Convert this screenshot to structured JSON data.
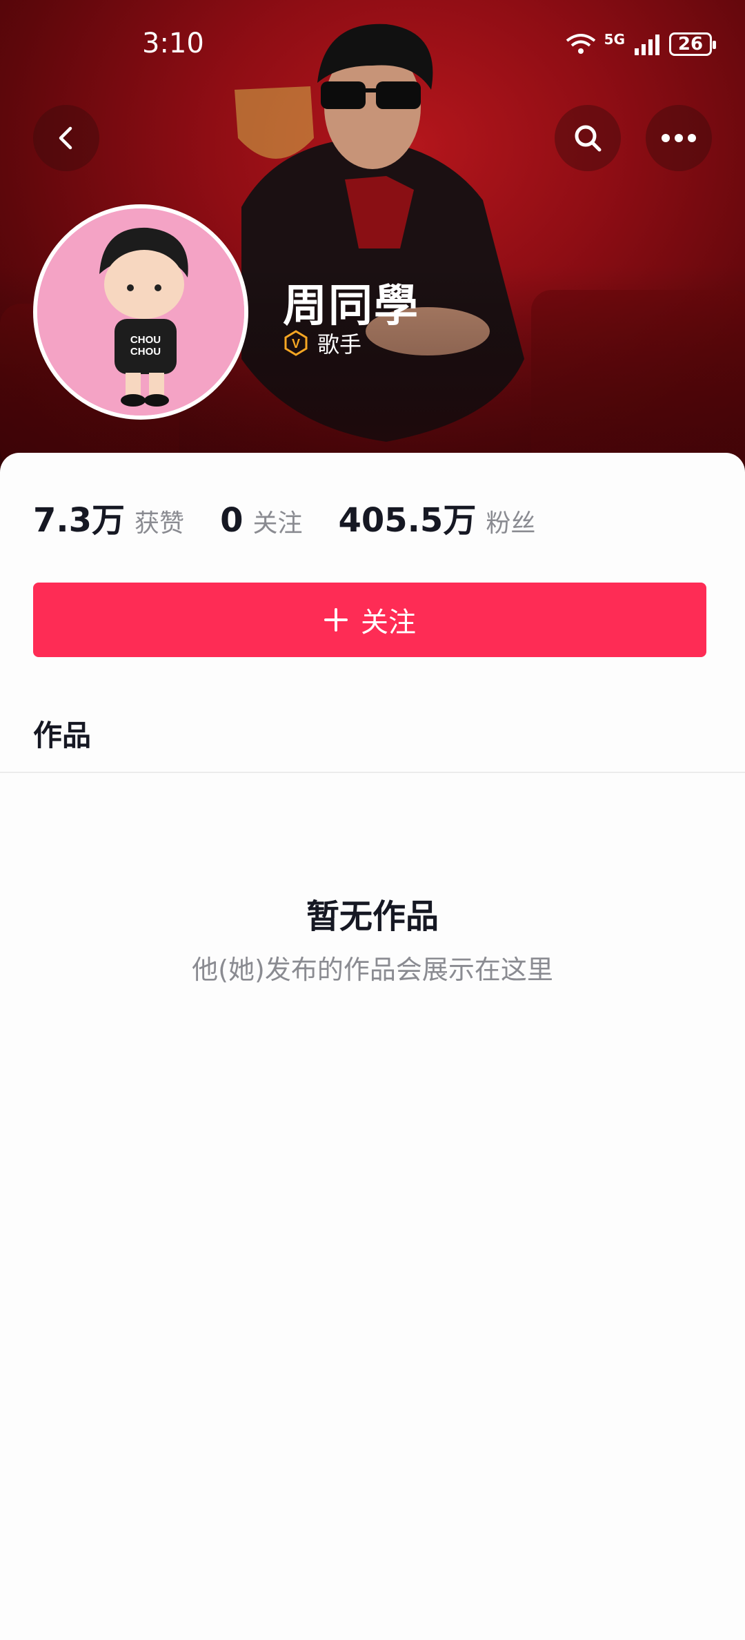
{
  "status_bar": {
    "time": "3:10",
    "network": "5G",
    "battery": "26"
  },
  "header": {
    "back_icon": "chevron-left-icon",
    "search_icon": "search-icon",
    "more_icon": "more-horizontal-icon"
  },
  "profile": {
    "name": "周同學",
    "role": "歌手",
    "verified_badge": "V",
    "avatar_text": "CHOU CHOU"
  },
  "stats": [
    {
      "value": "7.3万",
      "label": "获赞"
    },
    {
      "value": "0",
      "label": "关注"
    },
    {
      "value": "405.5万",
      "label": "粉丝"
    }
  ],
  "follow_button": {
    "label": "关注"
  },
  "tabs": {
    "works": "作品"
  },
  "empty_state": {
    "title": "暂无作品",
    "subtitle": "他(她)发布的作品会展示在这里"
  },
  "colors": {
    "accent": "#fe2c55",
    "header_red": "#8e0d14",
    "badge_orange": "#f5a623"
  }
}
